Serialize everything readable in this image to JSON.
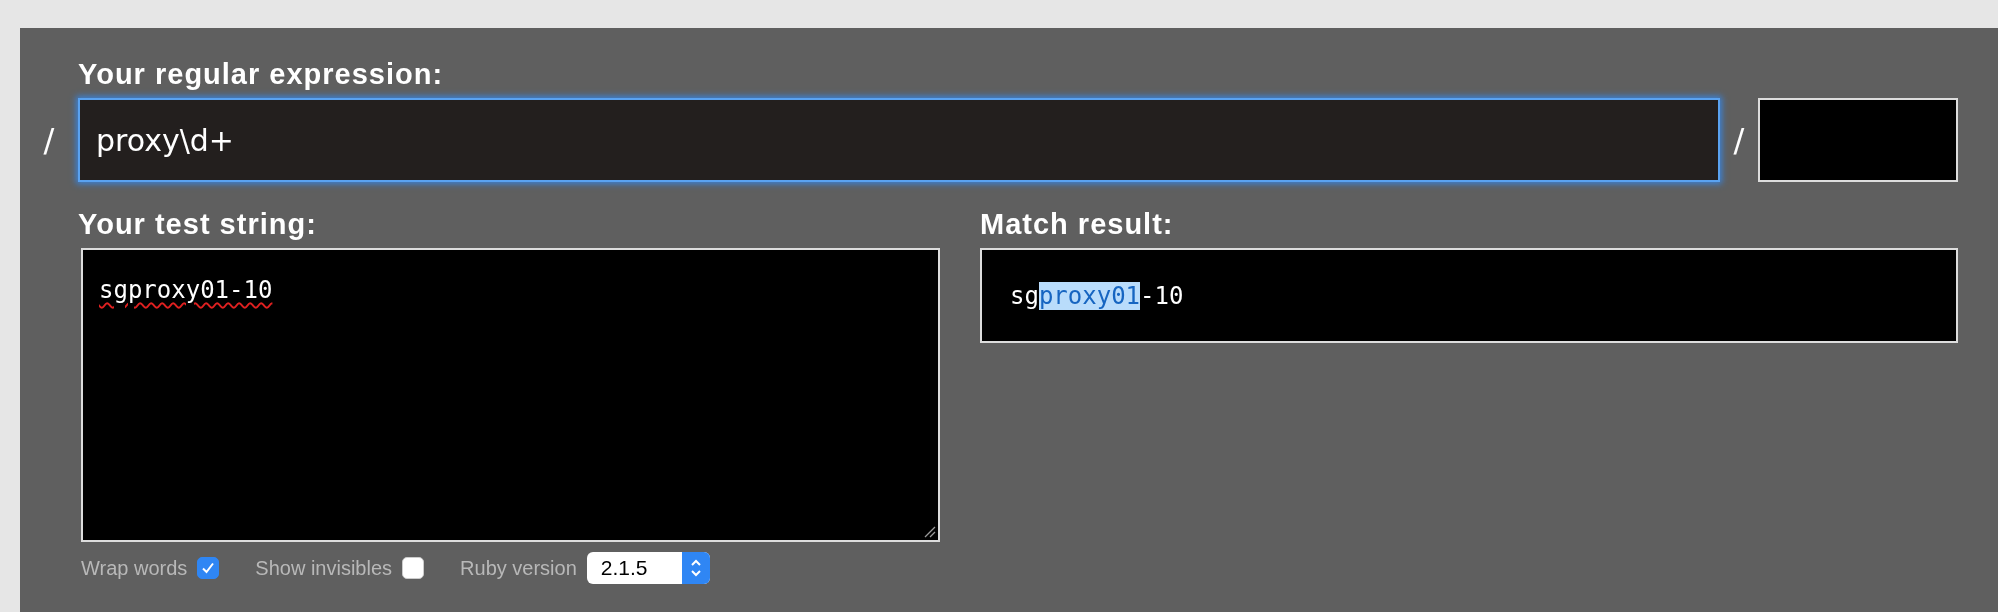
{
  "regex": {
    "label": "Your regular expression:",
    "delimiter_open": "/",
    "value": "proxy\\d+",
    "focused": true,
    "delimiter_close": "/"
  },
  "test_string": {
    "label": "Your test string:",
    "value": "sgproxy01-10",
    "misspelled": true
  },
  "match_result": {
    "label": "Match result:",
    "segments": [
      {
        "text": "sg",
        "matched": false
      },
      {
        "text": "proxy01",
        "matched": true
      },
      {
        "text": "-10",
        "matched": false
      }
    ]
  },
  "options": [
    {
      "label": "Wrap words",
      "checked": true
    },
    {
      "label": "Show invisibles",
      "checked": false
    }
  ],
  "ruby_version": {
    "label": "Ruby version",
    "value": "2.1.5"
  }
}
